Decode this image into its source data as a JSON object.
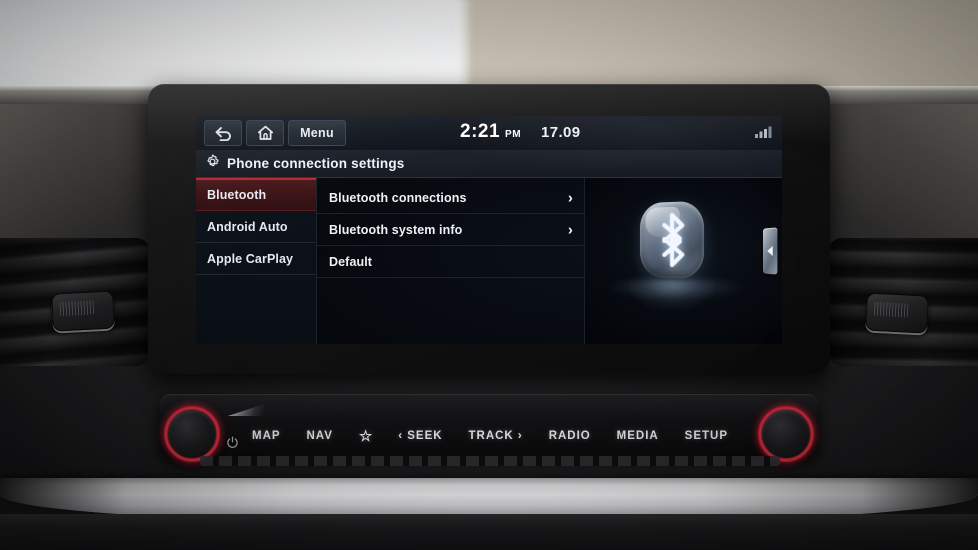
{
  "status_bar": {
    "back_icon": "back-arrow-icon",
    "home_icon": "home-icon",
    "menu_label": "Menu",
    "time": "2:21",
    "ampm": "PM",
    "temperature": "17.09",
    "signal_icon": "signal-strength-icon"
  },
  "title_bar": {
    "gear_icon": "gear-icon",
    "title": "Phone connection settings"
  },
  "nav": {
    "items": [
      {
        "label": "Bluetooth",
        "active": true
      },
      {
        "label": "Android Auto",
        "active": false
      },
      {
        "label": "Apple CarPlay",
        "active": false
      }
    ]
  },
  "list": {
    "items": [
      {
        "label": "Bluetooth connections",
        "chevron": "›"
      },
      {
        "label": "Bluetooth system info",
        "chevron": "›"
      },
      {
        "label": "Default",
        "chevron": ""
      }
    ]
  },
  "logo_panel": {
    "logo": "bluetooth-logo",
    "collapse_tab": "collapse-panel-arrow-icon"
  },
  "hardware": {
    "left_knob": "volume-power-knob",
    "right_knob": "tune-knob",
    "power_icon": "power-icon",
    "buttons": [
      {
        "label": "MAP",
        "name": "map-button"
      },
      {
        "label": "NAV",
        "name": "nav-button"
      },
      {
        "label": "☆",
        "name": "favourites-star-button"
      },
      {
        "label": "‹ SEEK",
        "name": "seek-button"
      },
      {
        "label": "TRACK ›",
        "name": "track-button"
      },
      {
        "label": "RADIO",
        "name": "radio-button"
      },
      {
        "label": "MEDIA",
        "name": "media-button"
      },
      {
        "label": "SETUP",
        "name": "setup-button"
      }
    ]
  },
  "colors": {
    "accent_red": "#c0262c",
    "knob_ring": "#8e1f2b",
    "screen_bg": "#05070c",
    "text": "#eef1f5"
  }
}
